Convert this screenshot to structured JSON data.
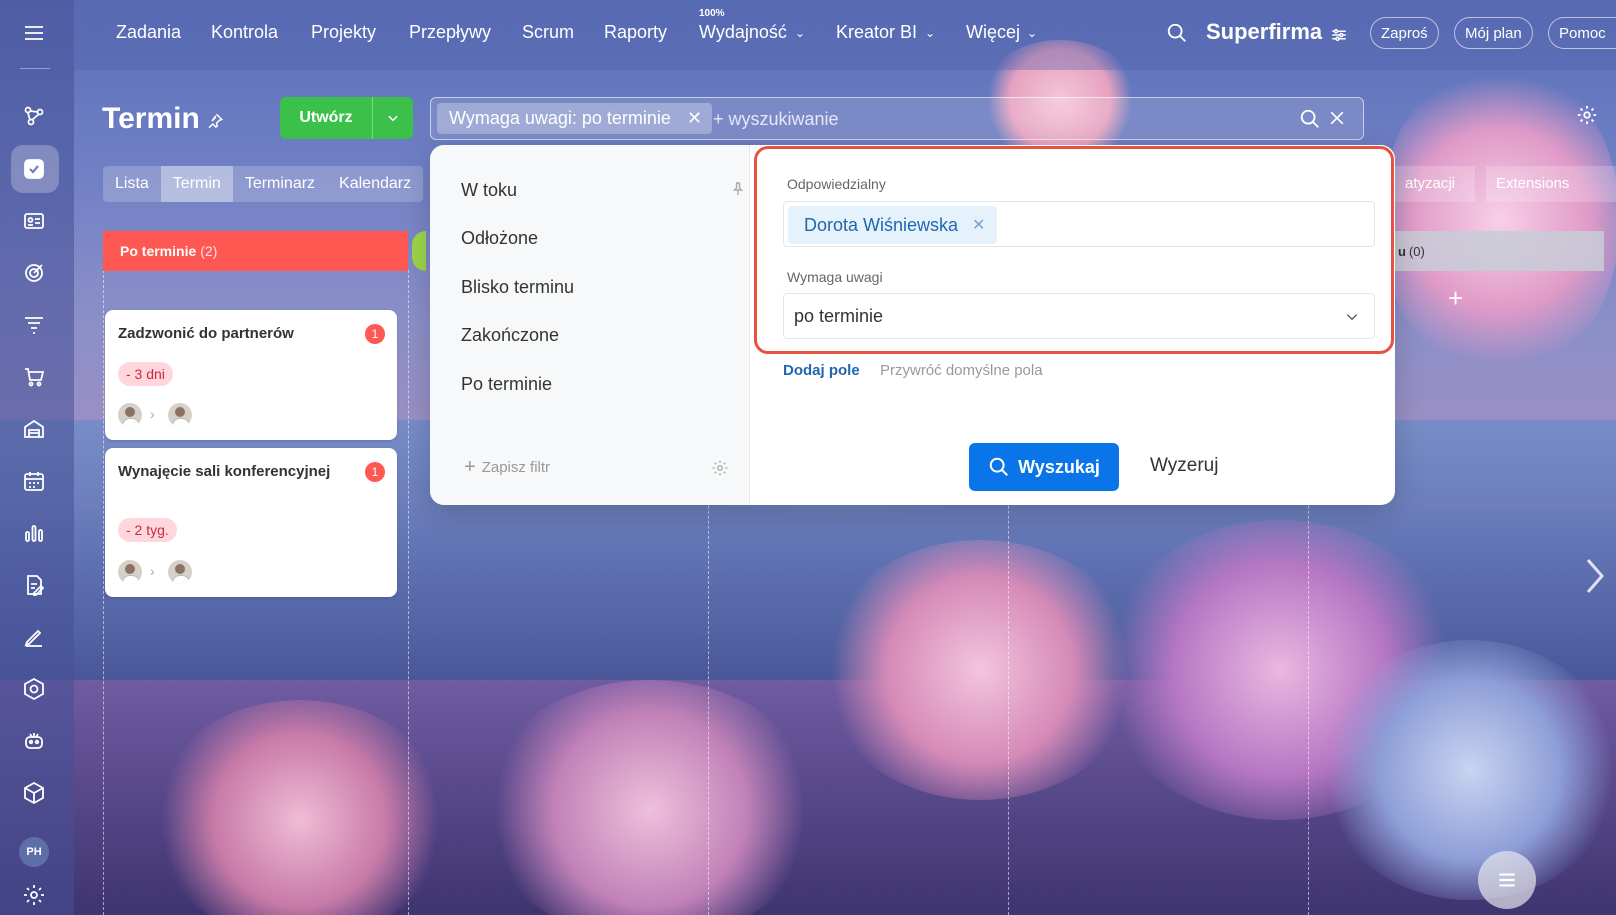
{
  "topnav": {
    "items": [
      "Zadania",
      "Kontrola",
      "Projekty",
      "Przepływy",
      "Scrum",
      "Raporty",
      "Wydajność",
      "Kreator BI",
      "Więcej"
    ],
    "efficiency_badge": "100%",
    "brand": "Superfirma",
    "invite": "Zaproś",
    "my_plan": "Mój plan",
    "help": "Pomoc"
  },
  "sidebar": {
    "icons": [
      "menu-icon",
      "flow-icon",
      "tasks-icon",
      "crm-icon",
      "target-icon",
      "funnel-icon",
      "cart-icon",
      "warehouse-icon",
      "calendar-icon",
      "analytics-icon",
      "docs-icon",
      "sign-icon",
      "hexagon-icon",
      "robot-icon",
      "box-icon"
    ],
    "avatar_initials": "PH"
  },
  "page": {
    "title": "Termin",
    "create_label": "Utwórz",
    "search": {
      "chip": "Wymaga uwagi: po terminie",
      "placeholder": "+ wyszukiwanie"
    },
    "tabs": [
      "Lista",
      "Termin",
      "Terminarz",
      "Kalendarz"
    ],
    "active_tab": "Termin",
    "right_tabs": [
      "atyzacji",
      "Extensions"
    ]
  },
  "kanban": {
    "columns": [
      {
        "title": "Po terminie",
        "count": "(2)",
        "color": "#ff5752"
      },
      {
        "title": "u",
        "count": "(0)",
        "color": "#c8cdd7"
      }
    ],
    "cards": [
      {
        "title": "Zadzwonić do partnerów",
        "badge": "1",
        "deadline": "- 3 dni"
      },
      {
        "title": "Wynajęcie sali konferencyjnej",
        "badge": "1",
        "deadline": "- 2 tyg."
      }
    ]
  },
  "filter_popup": {
    "presets": [
      "W toku",
      "Odłożone",
      "Blisko terminu",
      "Zakończone",
      "Po terminie"
    ],
    "save_filter": "Zapisz filtr",
    "fields": {
      "responsible_label": "Odpowiedzialny",
      "responsible_value": "Dorota Wiśniewska",
      "attention_label": "Wymaga uwagi",
      "attention_value": "po terminie"
    },
    "add_field": "Dodaj pole",
    "restore_defaults": "Przywróć domyślne pola",
    "search_button": "Wyszukaj",
    "reset_button": "Wyzeruj"
  },
  "colors": {
    "accent_blue": "#0a75e8",
    "create_green": "#3bc14a",
    "overdue_red": "#ff5752",
    "highlight_border": "#e8533f"
  }
}
